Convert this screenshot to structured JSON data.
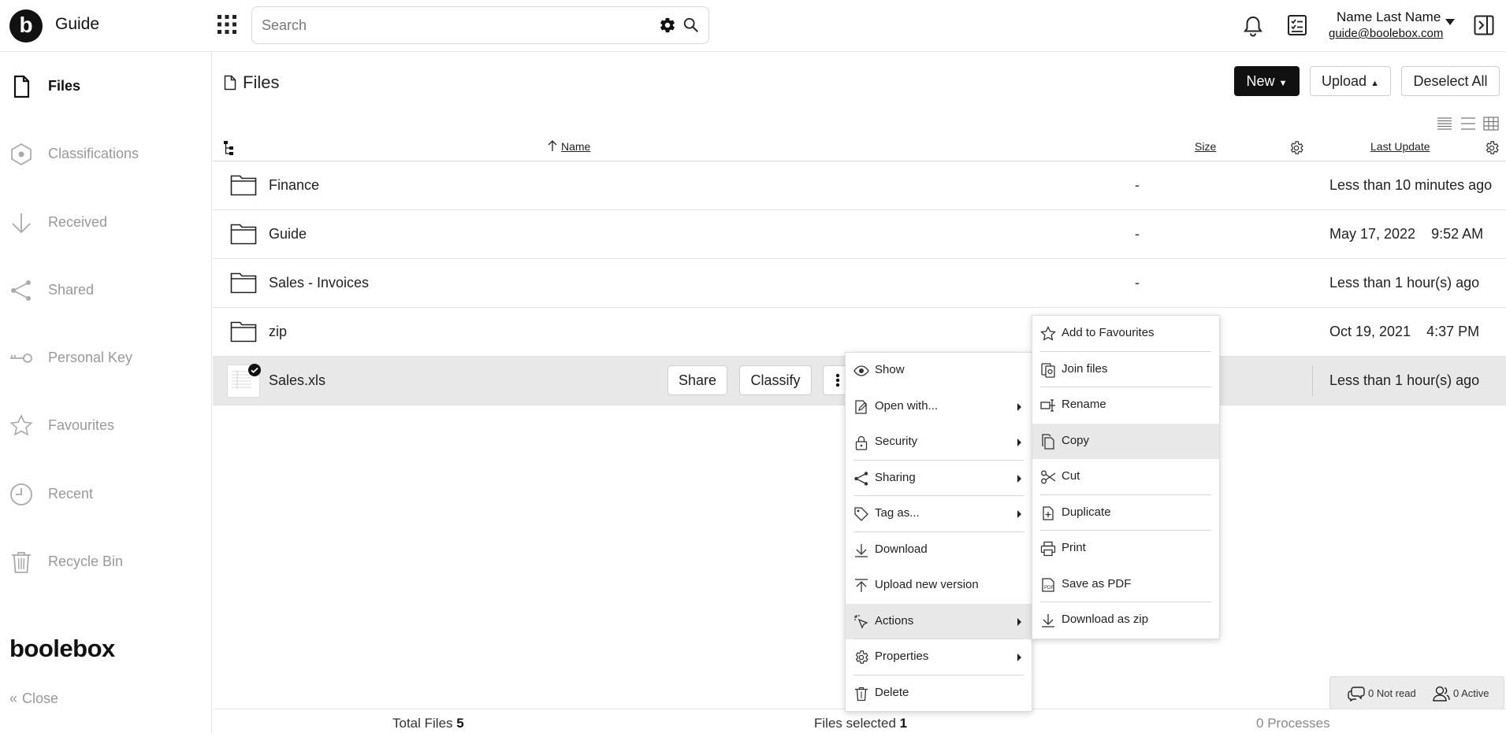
{
  "app": {
    "title": "Guide",
    "logo_letter": "b"
  },
  "search": {
    "placeholder": "Search"
  },
  "user": {
    "name": "Name Last Name",
    "email": "guide@boolebox.com"
  },
  "sidebar": {
    "items": [
      {
        "label": "Files",
        "icon": "file-icon",
        "active": true
      },
      {
        "label": "Classifications",
        "icon": "hexagon-icon"
      },
      {
        "label": "Received",
        "icon": "arrow-down-icon"
      },
      {
        "label": "Shared",
        "icon": "share-icon"
      },
      {
        "label": "Personal Key",
        "icon": "key-icon"
      },
      {
        "label": "Favourites",
        "icon": "star-icon"
      },
      {
        "label": "Recent",
        "icon": "clock-icon"
      },
      {
        "label": "Recycle Bin",
        "icon": "trash-icon"
      }
    ],
    "brand": "boolebox",
    "close_label": "Close"
  },
  "main": {
    "title": "Files",
    "buttons": {
      "new": "New",
      "upload": "Upload",
      "deselect": "Deselect All"
    },
    "columns": {
      "name": "Name",
      "size": "Size",
      "last_update": "Last Update"
    },
    "rows": [
      {
        "name": "Finance",
        "size": "-",
        "date": "Less than 10 minutes ago"
      },
      {
        "name": "Guide",
        "size": "-",
        "date": "May 17, 2022    9:52 AM"
      },
      {
        "name": "Sales - Invoices",
        "size": "-",
        "date": "Less than 1 hour(s) ago"
      },
      {
        "name": "zip",
        "size": "",
        "date": "Oct 19, 2021    4:37 PM"
      },
      {
        "name": "Sales.xls",
        "size": "",
        "date": "Less than 1 hour(s) ago",
        "share_label": "Share",
        "classify_label": "Classify"
      }
    ]
  },
  "context_menu": {
    "items": [
      "Show",
      "Open with...",
      "Security",
      "Sharing",
      "Tag as...",
      "Download",
      "Upload new version",
      "Actions",
      "Properties",
      "Delete"
    ]
  },
  "actions_menu": {
    "items": [
      "Add to Favourites",
      "Join files",
      "Rename",
      "Copy",
      "Cut",
      "Duplicate",
      "Print",
      "Save as PDF",
      "Download as zip"
    ]
  },
  "footer": {
    "total_label": "Total Files",
    "total_value": "5",
    "selected_label": "Files selected",
    "selected_value": "1",
    "processes_value": "0",
    "processes_label": "Processes"
  },
  "chat": {
    "not_read": "0 Not read",
    "active": "0 Active"
  }
}
